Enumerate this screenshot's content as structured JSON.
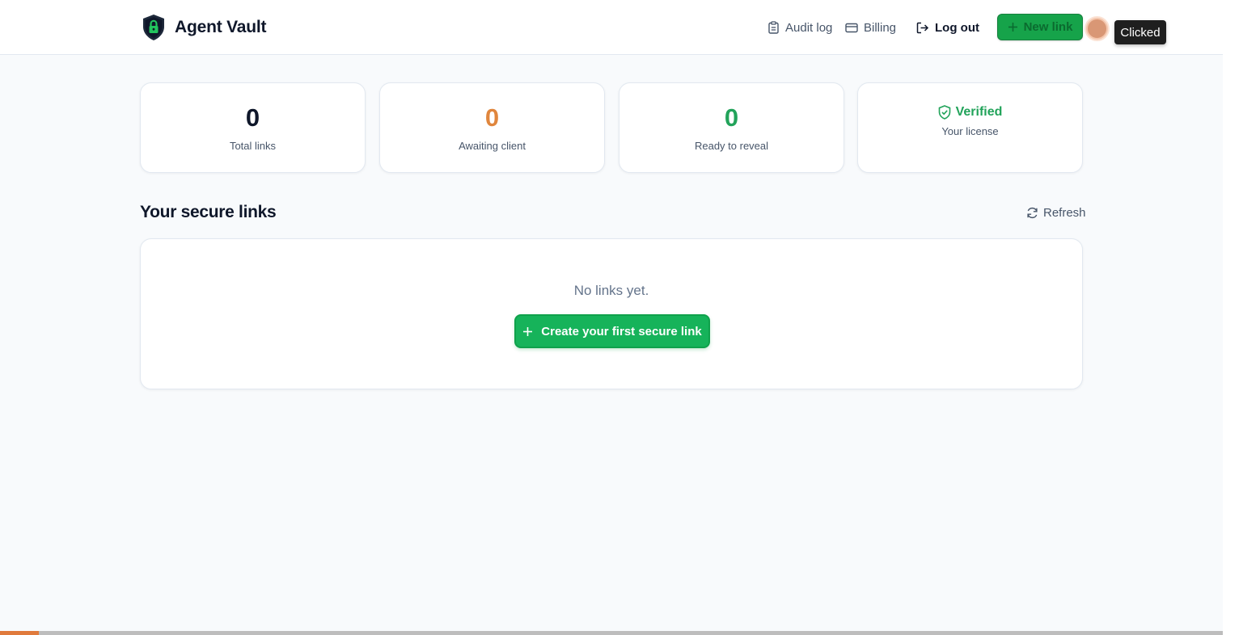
{
  "header": {
    "brand_name": "Agent Vault",
    "nav": {
      "audit_log": "Audit log",
      "billing": "Billing",
      "log_out": "Log out"
    },
    "new_link_label": "New link",
    "tooltip": "Clicked"
  },
  "stats": [
    {
      "value": "0",
      "label": "Total links",
      "color": "#0f172a"
    },
    {
      "value": "0",
      "label": "Awaiting client",
      "color": "#e0863d"
    },
    {
      "value": "0",
      "label": "Ready to reveal",
      "color": "#22a35a"
    }
  ],
  "license": {
    "status": "Verified",
    "label": "Your license",
    "color": "#22a35a"
  },
  "links_section": {
    "title": "Your secure links",
    "refresh_label": "Refresh",
    "empty_text": "No links yet.",
    "create_label": "Create your first secure link"
  },
  "colors": {
    "accent_green": "#16b35a",
    "page_bg": "#f8fafc",
    "bottom_bar_fill": "#e07a3c"
  },
  "progress": {
    "bottom_bar_fraction": 0.032
  }
}
